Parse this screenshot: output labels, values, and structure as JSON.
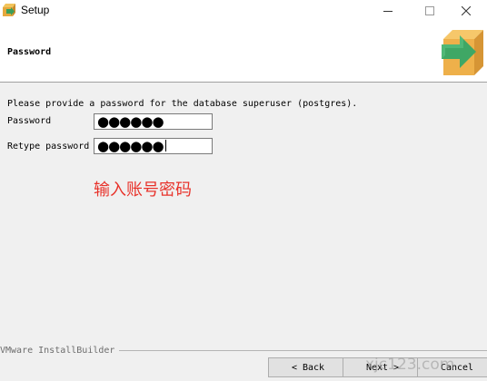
{
  "window": {
    "title": "Setup",
    "controls": {
      "minimize_icon": "minimize-icon",
      "maximize_icon": "maximize-icon",
      "close_icon": "close-icon"
    }
  },
  "header": {
    "title": "Password",
    "graphic_icon": "box-arrow-icon"
  },
  "form": {
    "prompt": "Please provide a password for the database superuser (postgres).",
    "password_label": "Password",
    "password_value": "●●●●●●",
    "retype_label": "Retype password",
    "retype_value": "●●●●●●"
  },
  "annotation": {
    "text": "输入账号密码",
    "color": "#e8332b"
  },
  "footer": {
    "brand": "VMware InstallBuilder",
    "back_label": "< Back",
    "next_label": "Next >",
    "cancel_label": "Cancel"
  },
  "watermark": {
    "text": "xjc123.com"
  }
}
